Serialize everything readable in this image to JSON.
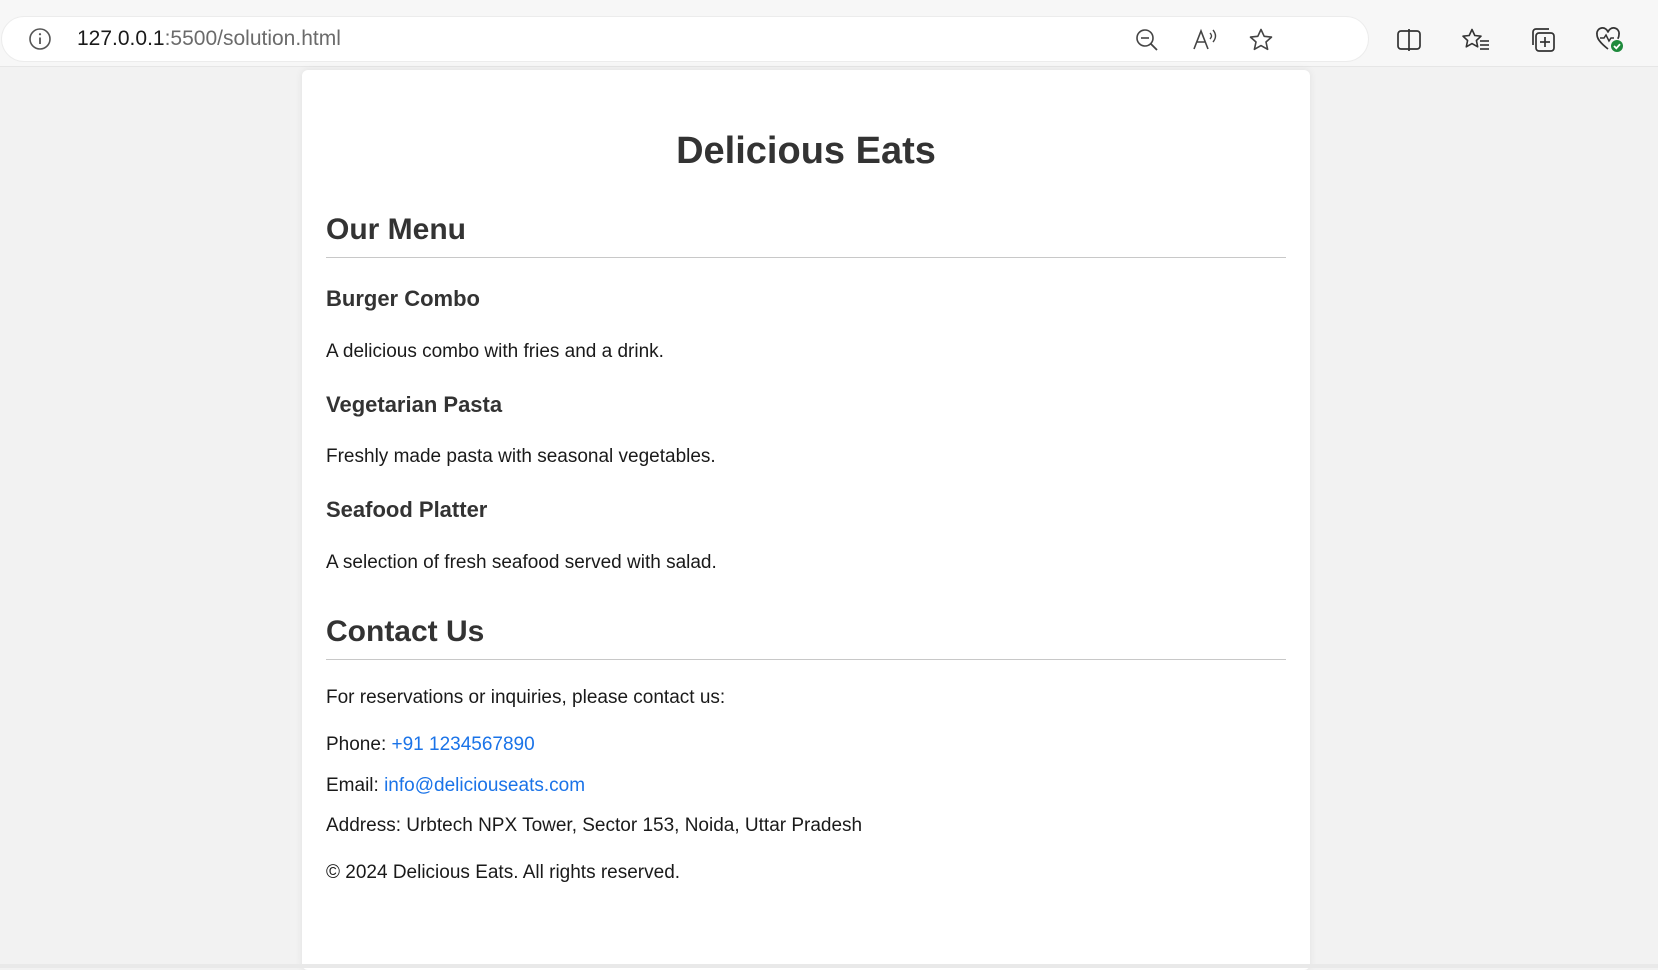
{
  "browser": {
    "url_host": "127.0.0.1",
    "url_rest": ":5500/solution.html"
  },
  "page": {
    "title": "Delicious Eats",
    "menu_heading": "Our Menu",
    "menu_items": [
      {
        "name": "Burger Combo",
        "description": "A delicious combo with fries and a drink."
      },
      {
        "name": "Vegetarian Pasta",
        "description": "Freshly made pasta with seasonal vegetables."
      },
      {
        "name": "Seafood Platter",
        "description": "A selection of fresh seafood served with salad."
      }
    ],
    "contact_heading": "Contact Us",
    "contact_intro": "For reservations or inquiries, please contact us:",
    "phone_label": "Phone:",
    "phone_value": "+91 1234567890",
    "email_label": "Email:",
    "email_value": "info@deliciouseats.com",
    "address": "Address: Urbtech NPX Tower, Sector 153, Noida, Uttar Pradesh",
    "footer": "© 2024 Delicious Eats. All rights reserved."
  },
  "colors": {
    "link": "#1a73e8",
    "heading": "#333333"
  }
}
